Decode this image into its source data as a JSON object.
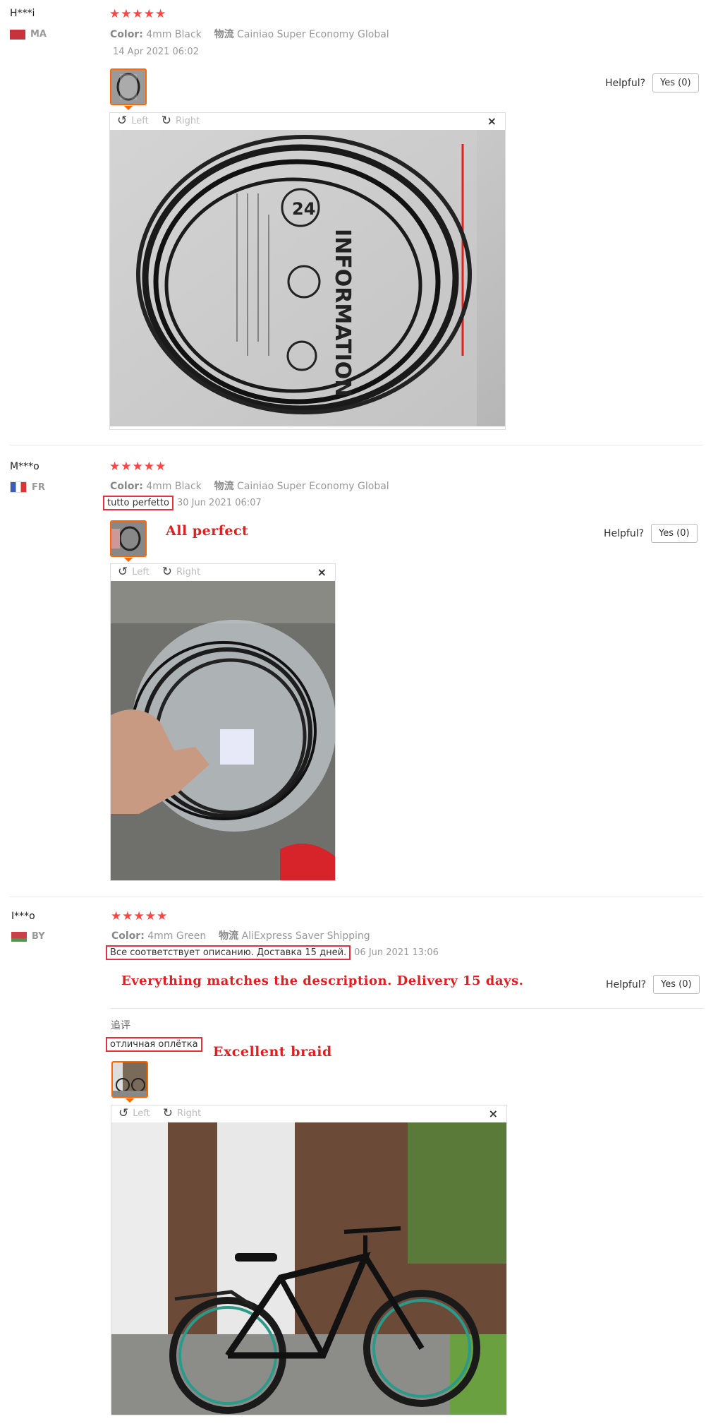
{
  "colors": {
    "star": "#f44",
    "accent": "#f60",
    "annotation": "#e02020",
    "highlight_box": "#e8303a"
  },
  "reviews": [
    {
      "name": "H***i",
      "country": "MA",
      "flag_color": "#c8323c",
      "stars": "★★★★★",
      "color_label": "Color:",
      "color_value": "4mm Black",
      "ship_label": "物流",
      "ship_value": "Cainiao Super Economy Global",
      "date": "14 Apr 2021 06:02",
      "helpful": "Helpful?",
      "yes": "Yes (0)",
      "viewer": {
        "left": "Left",
        "right": "Right",
        "close": "×"
      }
    },
    {
      "name": "M***o",
      "country": "FR",
      "flag_color": "#3b5bb5",
      "stars": "★★★★★",
      "color_label": "Color:",
      "color_value": "4mm Black",
      "ship_label": "物流",
      "ship_value": "Cainiao Super Economy Global",
      "feedback": "tutto perfetto",
      "date": "30 Jun 2021 06:07",
      "annotation": "All perfect",
      "helpful": "Helpful?",
      "yes": "Yes (0)",
      "viewer": {
        "left": "Left",
        "right": "Right",
        "close": "×"
      }
    },
    {
      "name": "I***o",
      "country": "BY",
      "flag_color": "#c8404a",
      "stars": "★★★★★",
      "color_label": "Color:",
      "color_value": "4mm Green",
      "ship_label": "物流",
      "ship_value": "AliExpress Saver Shipping",
      "feedback": "Все соответствует описанию. Доставка 15 дней.",
      "date": "06 Jun 2021 13:06",
      "annotation": "Everything matches the description. Delivery 15 days.",
      "helpful": "Helpful?",
      "yes": "Yes (0)",
      "append_label": "追评",
      "append_feedback": "отличная оплётка",
      "append_annotation": "Excellent braid",
      "viewer": {
        "left": "Left",
        "right": "Right",
        "close": "×"
      }
    }
  ],
  "photo_text": {
    "bag_brand": "INFORMATION",
    "bag_hours": "24"
  }
}
